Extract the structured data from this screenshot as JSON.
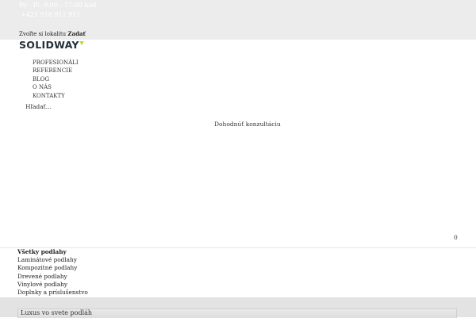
{
  "topbar": {
    "hours": "Po - Pi: 9:00 - 17:00 hod.",
    "phone": "+421 918 911 911",
    "location_prefix": "Zvoľte si lokalitu",
    "location_link": "Zadať"
  },
  "logo": {
    "text": "SOLIDWAY",
    "accent_color": "#c7d43b"
  },
  "nav": {
    "items": [
      "PROFESIONÁLI",
      "REFERENCIE",
      "BLOG",
      "O NÁS",
      "KONTAKTY"
    ]
  },
  "search": {
    "placeholder": "Hľadať..."
  },
  "cta": {
    "consult_label": "Dohodnúť konzultáciu"
  },
  "cart": {
    "count": "0"
  },
  "categories": {
    "items": [
      "Všetky podlahy",
      "Laminátové podlahy",
      "Kompozitné podlahy",
      "Drevené podlahy",
      "Vinylové podlahy",
      "Doplnky a príslušenstvo"
    ]
  },
  "hero": {
    "title": "Luxus vo svete podláh"
  }
}
